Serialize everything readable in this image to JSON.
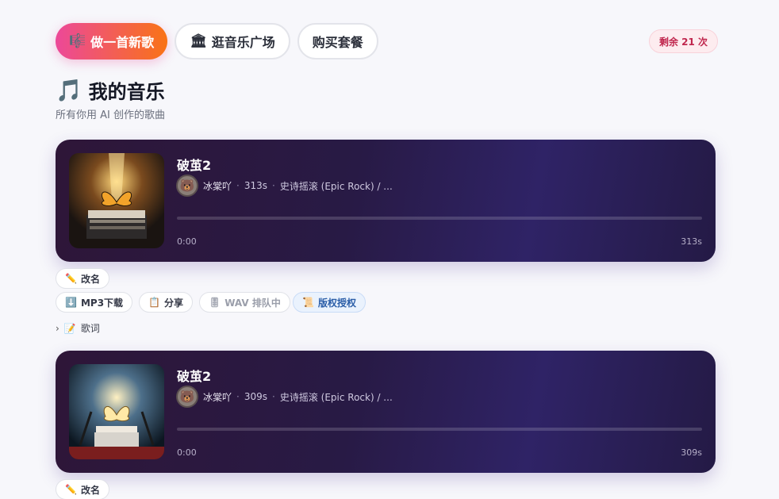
{
  "nav": {
    "make_song": {
      "icon": "🎼",
      "label": "做一首新歌"
    },
    "explore": {
      "icon": "🏛",
      "label": "逛音乐广场"
    },
    "buy": {
      "label": "购买套餐"
    }
  },
  "remaining": "剩余 21 次",
  "page": {
    "icon": "🎵",
    "title": "我的音乐",
    "subtitle": "所有你用 AI 创作的歌曲"
  },
  "songs": [
    {
      "title": "破茧2",
      "author": "冰棠吖",
      "duration": "313s",
      "style": "史诗摇滚 (Epic Rock) / ...",
      "time_start": "0:00",
      "time_end": "313s",
      "progress": 0,
      "cover_icon": "butterfly-on-books"
    },
    {
      "title": "破茧2",
      "author": "冰棠吖",
      "duration": "309s",
      "style": "史诗摇滚 (Epic Rock) / ...",
      "time_start": "0:00",
      "time_end": "309s",
      "progress": 0,
      "cover_icon": "butterfly-on-books"
    }
  ],
  "actions": {
    "rename": {
      "icon": "✏️",
      "label": "改名"
    },
    "download_mp3": {
      "icon": "⬇️",
      "label": "MP3下载"
    },
    "share": {
      "icon": "📋",
      "label": "分享"
    },
    "wav": {
      "icon": "🎚",
      "label": "WAV 排队中"
    },
    "license": {
      "icon": "📜",
      "label": "版权授权"
    },
    "lyrics": {
      "icon": "📝",
      "label": "歌词"
    }
  },
  "colors": {
    "accent_start": "#ec4899",
    "accent_end": "#f97316",
    "card_bg": "#2a1a48",
    "badge": "#c0264d"
  }
}
